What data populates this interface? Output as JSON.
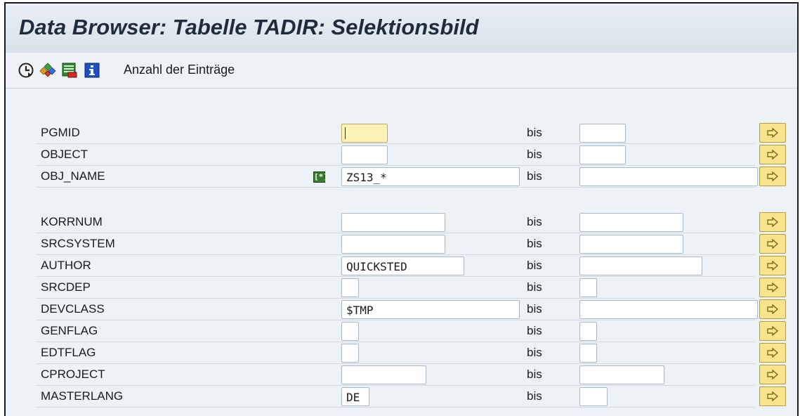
{
  "window": {
    "title": "Data Browser: Tabelle TADIR: Selektionsbild"
  },
  "toolbar": {
    "icons": [
      "execute-clock-icon",
      "colored-diamonds-icon",
      "table-red-icon",
      "info-icon"
    ],
    "count_label": "Anzahl der Einträge"
  },
  "colors": {
    "focus_field": "#fff3b8",
    "multi_button": "#f9e48c",
    "background": "#edf2f7"
  },
  "selection": {
    "to_label": "bis",
    "rows": [
      {
        "name": "PGMID",
        "from": "",
        "to": ""
      },
      {
        "name": "OBJECT",
        "from": "",
        "to": ""
      },
      {
        "name": "OBJ_NAME",
        "from": "ZS13_*",
        "to": "",
        "option_icon": "pattern-select-icon"
      },
      {
        "name": "KORRNUM",
        "from": "",
        "to": ""
      },
      {
        "name": "SRCSYSTEM",
        "from": "",
        "to": ""
      },
      {
        "name": "AUTHOR",
        "from": "QUICKSTED",
        "to": ""
      },
      {
        "name": "SRCDEP",
        "from": "",
        "to": ""
      },
      {
        "name": "DEVCLASS",
        "from": "$TMP",
        "to": ""
      },
      {
        "name": "GENFLAG",
        "from": "",
        "to": ""
      },
      {
        "name": "EDTFLAG",
        "from": "",
        "to": ""
      },
      {
        "name": "CPROJECT",
        "from": "",
        "to": ""
      },
      {
        "name": "MASTERLANG",
        "from": "DE",
        "to": ""
      }
    ]
  }
}
